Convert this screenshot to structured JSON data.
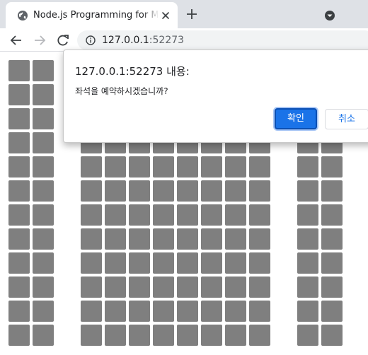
{
  "tab": {
    "title": "Node.js Programming for Modern Web",
    "favicon": "globe-icon",
    "close_icon": "close-icon"
  },
  "toolbar": {
    "back_icon": "back-arrow-icon",
    "forward_icon": "forward-arrow-icon",
    "reload_icon": "reload-icon",
    "security_icon": "info-icon",
    "url_host": "127.0.0.1",
    "url_port": ":52273"
  },
  "tabstrip": {
    "new_tab_icon": "plus-icon",
    "tab_search_icon": "dropdown-circle-icon"
  },
  "dialog": {
    "title": "127.0.0.1:52273 내용:",
    "message": "좌석을 예약하시겠습니까?",
    "ok_label": "확인",
    "cancel_label": "취소"
  },
  "seats": {
    "color": "#7f7f7f",
    "rows": 12
  },
  "colors": {
    "accent": "#1a73e8",
    "tabstrip": "#dee1e6",
    "omnibox": "#f1f3f4"
  }
}
